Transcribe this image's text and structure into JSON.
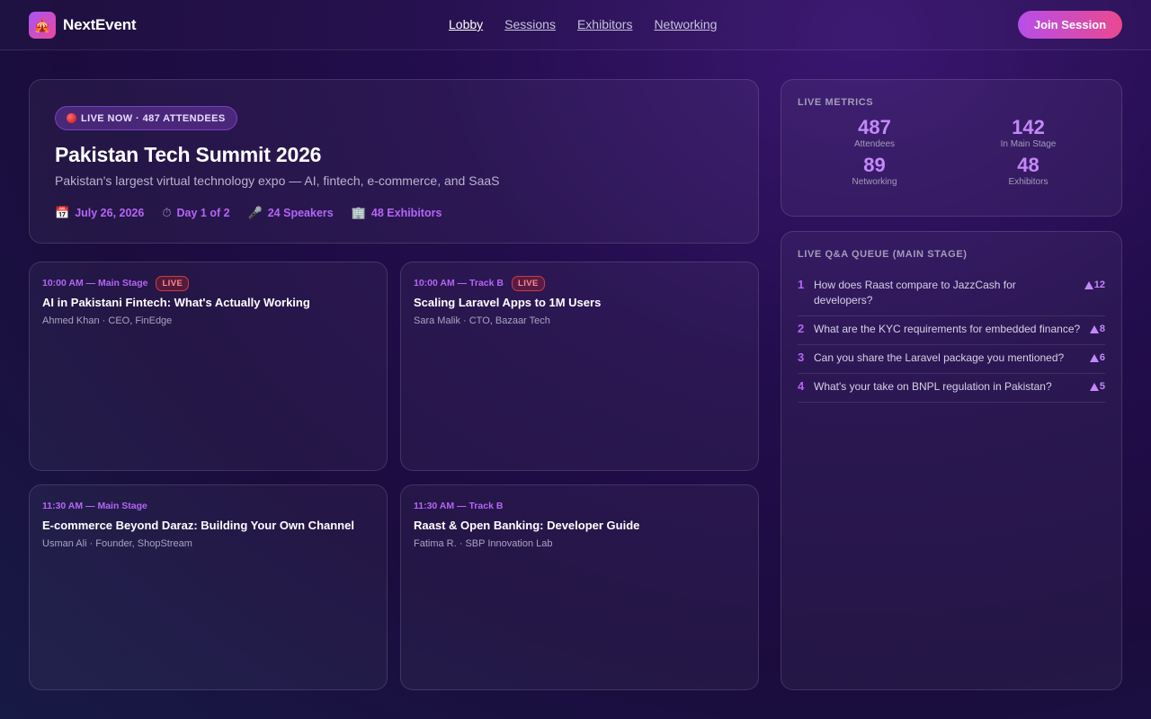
{
  "header": {
    "logo_icon": "circus-tent-icon",
    "brand": "NextEvent",
    "nav": [
      {
        "label": "Lobby",
        "active": true
      },
      {
        "label": "Sessions",
        "active": false
      },
      {
        "label": "Exhibitors",
        "active": false
      },
      {
        "label": "Networking",
        "active": false
      }
    ],
    "join_label": "Join Session"
  },
  "hero": {
    "live_label": "LIVE NOW · 487 ATTENDEES",
    "title": "Pakistan Tech Summit 2026",
    "subtitle": "Pakistan's largest virtual technology expo — AI, fintech, e-commerce, and SaaS",
    "meta": [
      {
        "icon": "calendar-icon",
        "text": "July 26, 2026"
      },
      {
        "icon": "stopwatch-icon",
        "text": "Day 1 of 2"
      },
      {
        "icon": "microphone-icon",
        "text": "24 Speakers"
      },
      {
        "icon": "building-icon",
        "text": "48 Exhibitors"
      }
    ]
  },
  "sessions": [
    {
      "time": "10:00 AM — Main Stage",
      "live": "LIVE",
      "title": "AI in Pakistani Fintech: What's Actually Working",
      "speaker": "Ahmed Khan · CEO, FinEdge"
    },
    {
      "time": "10:00 AM — Track B",
      "live": "LIVE",
      "title": "Scaling Laravel Apps to 1M Users",
      "speaker": "Sara Malik · CTO, Bazaar Tech"
    },
    {
      "time": "11:30 AM — Main Stage",
      "live": "",
      "title": "E-commerce Beyond Daraz: Building Your Own Channel",
      "speaker": "Usman Ali · Founder, ShopStream"
    },
    {
      "time": "11:30 AM — Track B",
      "live": "",
      "title": "Raast & Open Banking: Developer Guide",
      "speaker": "Fatima R. · SBP Innovation Lab"
    }
  ],
  "metrics": {
    "title": "LIVE METRICS",
    "items": [
      {
        "value": "487",
        "label": "Attendees"
      },
      {
        "value": "142",
        "label": "In Main Stage"
      },
      {
        "value": "89",
        "label": "Networking"
      },
      {
        "value": "48",
        "label": "Exhibitors"
      }
    ]
  },
  "qa": {
    "title": "LIVE Q&A QUEUE (MAIN STAGE)",
    "items": [
      {
        "num": "1",
        "text": "How does Raast compare to JazzCash for developers?",
        "votes": "12"
      },
      {
        "num": "2",
        "text": "What are the KYC requirements for embedded finance?",
        "votes": "8"
      },
      {
        "num": "3",
        "text": "Can you share the Laravel package you mentioned?",
        "votes": "6"
      },
      {
        "num": "4",
        "text": "What's your take on BNPL regulation in Pakistan?",
        "votes": "5"
      }
    ]
  },
  "colors": {
    "accent": "#b565f5",
    "brand_gradient_start": "#b84ee8",
    "brand_gradient_end": "#e9498f",
    "live_red": "#d23a3a"
  }
}
